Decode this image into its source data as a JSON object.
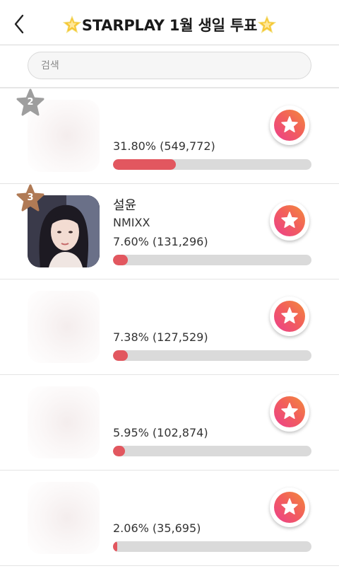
{
  "header": {
    "title": "STARPLAY 1월 생일 투표",
    "back_icon": "chevron-left-icon",
    "decoration_icon": "glowing-star-icon"
  },
  "search": {
    "placeholder": "검색",
    "value": ""
  },
  "colors": {
    "accent": "#e2575f",
    "vote_gradient": [
      "#ec3f8d",
      "#f38b3c"
    ],
    "rank_badge_2": "#9e9e9e",
    "rank_badge_3": "#b07a55",
    "bar_track": "#dadada"
  },
  "candidates": [
    {
      "rank": "2",
      "name": "",
      "group": "",
      "stat": "31.80% (549,772)",
      "percent": 31.8,
      "thumb": "blurred"
    },
    {
      "rank": "3",
      "name": "설윤",
      "group": "NMIXX",
      "stat": "7.60% (131,296)",
      "percent": 7.6,
      "thumb": "photo"
    },
    {
      "rank": "",
      "name": "",
      "group": "",
      "stat": "7.38% (127,529)",
      "percent": 7.38,
      "thumb": "blurred"
    },
    {
      "rank": "",
      "name": "",
      "group": "",
      "stat": "5.95% (102,874)",
      "percent": 5.95,
      "thumb": "blurred"
    },
    {
      "rank": "",
      "name": "",
      "group": "",
      "stat": "2.06% (35,695)",
      "percent": 2.06,
      "thumb": "blurred"
    }
  ],
  "vote_icon": "star-icon"
}
